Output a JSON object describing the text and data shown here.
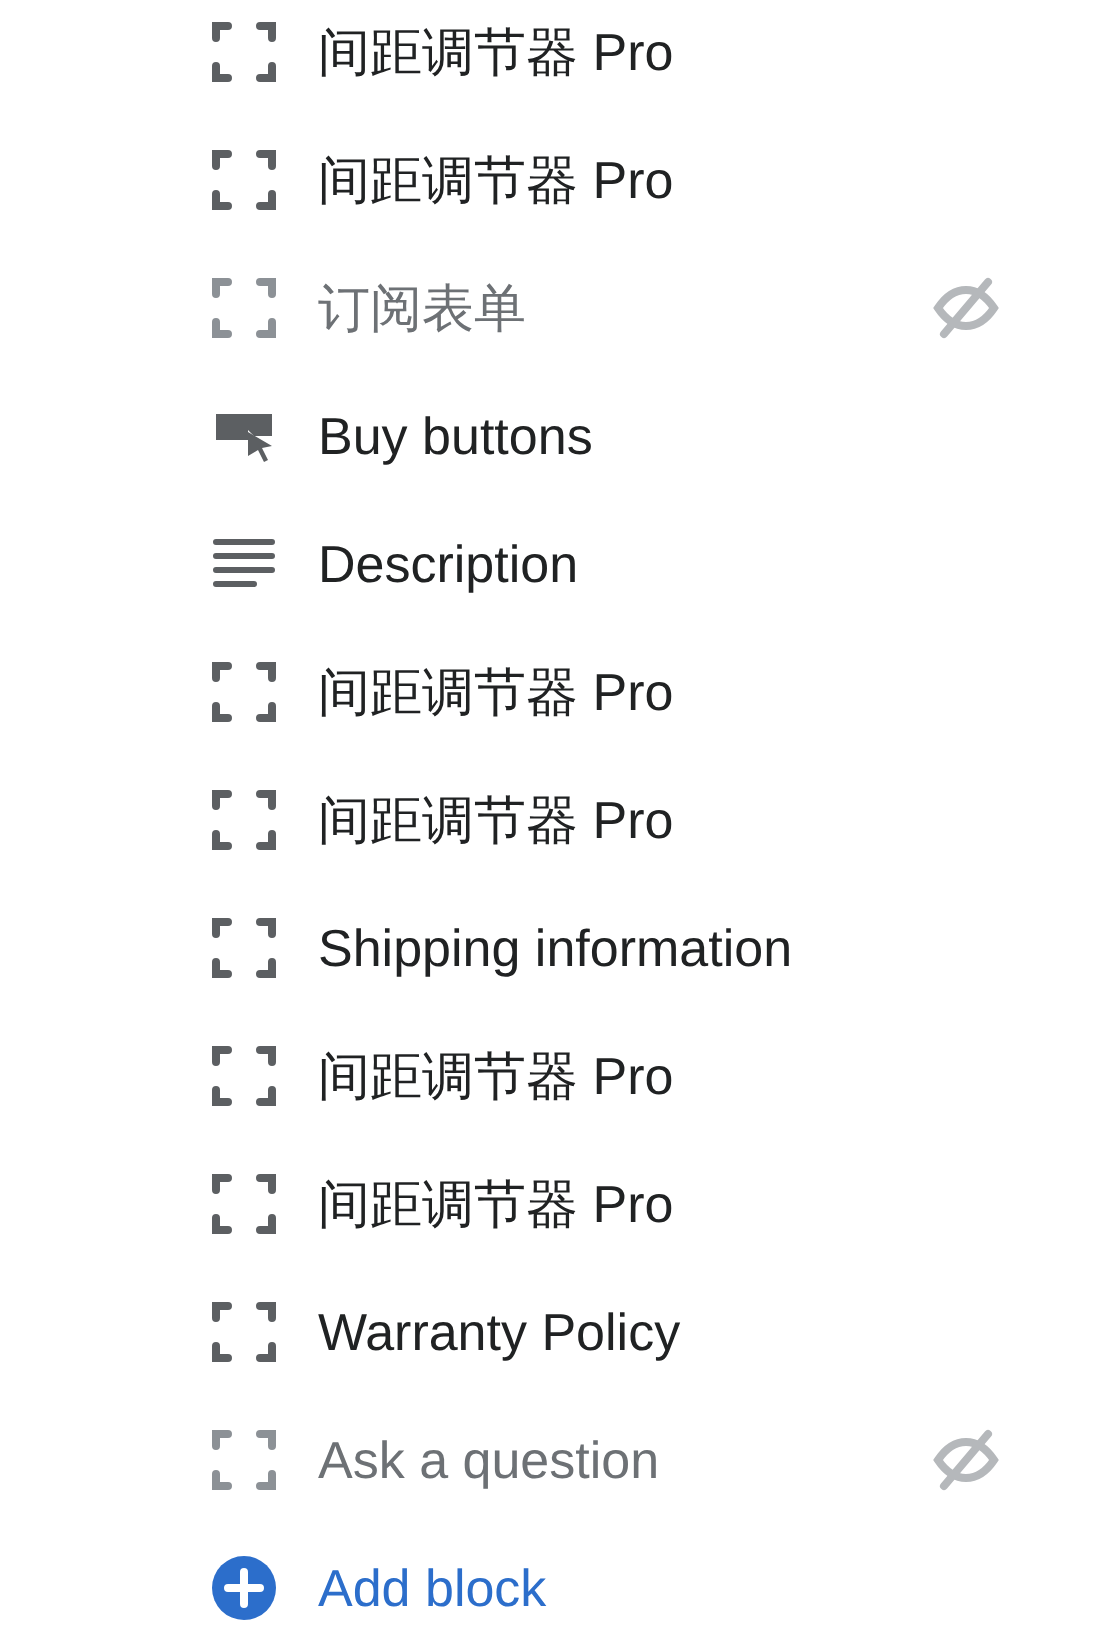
{
  "blocks": [
    {
      "kind": "spacer",
      "label": "间距调节器 Pro",
      "hidden": false
    },
    {
      "kind": "spacer",
      "label": "间距调节器 Pro",
      "hidden": false
    },
    {
      "kind": "spacer",
      "label": "订阅表单",
      "hidden": true
    },
    {
      "kind": "buy",
      "label": "Buy buttons",
      "hidden": false
    },
    {
      "kind": "text",
      "label": "Description",
      "hidden": false
    },
    {
      "kind": "spacer",
      "label": "间距调节器 Pro",
      "hidden": false
    },
    {
      "kind": "spacer",
      "label": "间距调节器 Pro",
      "hidden": false
    },
    {
      "kind": "spacer",
      "label": "Shipping information",
      "hidden": false
    },
    {
      "kind": "spacer",
      "label": "间距调节器 Pro",
      "hidden": false
    },
    {
      "kind": "spacer",
      "label": "间距调节器 Pro",
      "hidden": false
    },
    {
      "kind": "spacer",
      "label": "Warranty Policy",
      "hidden": false
    },
    {
      "kind": "spacer",
      "label": "Ask a question",
      "hidden": true
    }
  ],
  "add_block": {
    "label": "Add block"
  }
}
